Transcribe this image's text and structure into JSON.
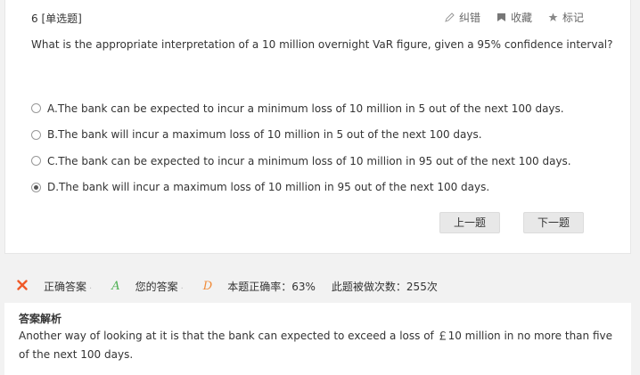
{
  "question": {
    "number_type": "6 [单选题]",
    "text": "What is the appropriate interpretation of a 10 million overnight VaR figure, given a 95% confidence interval?",
    "tools": [
      {
        "label": "纠错",
        "icon": "pencil-icon"
      },
      {
        "label": "收藏",
        "icon": "bookmark-icon"
      },
      {
        "label": "标记",
        "icon": "star-icon"
      }
    ],
    "options": [
      {
        "label": "A.The bank can be expected to incur a minimum loss of 10 million in 5 out of the next 100 days.",
        "checked": false
      },
      {
        "label": "B.The bank will incur a maximum loss of 10 million in 5 out of the next 100 days.",
        "checked": false
      },
      {
        "label": "C.The bank can be expected to incur a minimum loss of 10 million in 95 out of the next 100 days.",
        "checked": false
      },
      {
        "label": "D.The bank will incur a maximum loss of 10 million in 95 out of the next 100 days.",
        "checked": true
      }
    ]
  },
  "navigation": {
    "prev_label": "上一题",
    "next_label": "下一题"
  },
  "result": {
    "correct_answer_label": "正确答案",
    "correct_answer_value": "A",
    "your_answer_label": "您的答案",
    "your_answer_value": "D",
    "accuracy_text": "本题正确率：63%",
    "attempts_text": "此题被做次数：255次",
    "colors": {
      "wrong": "#f05a28",
      "correct": "#4caf50",
      "yours": "#f08c3a"
    }
  },
  "analysis": {
    "title": "答案解析",
    "text": " Another way of looking at it is that the bank can expected to exceed a loss of ￡10 million in no more than five of the next 100 days."
  }
}
